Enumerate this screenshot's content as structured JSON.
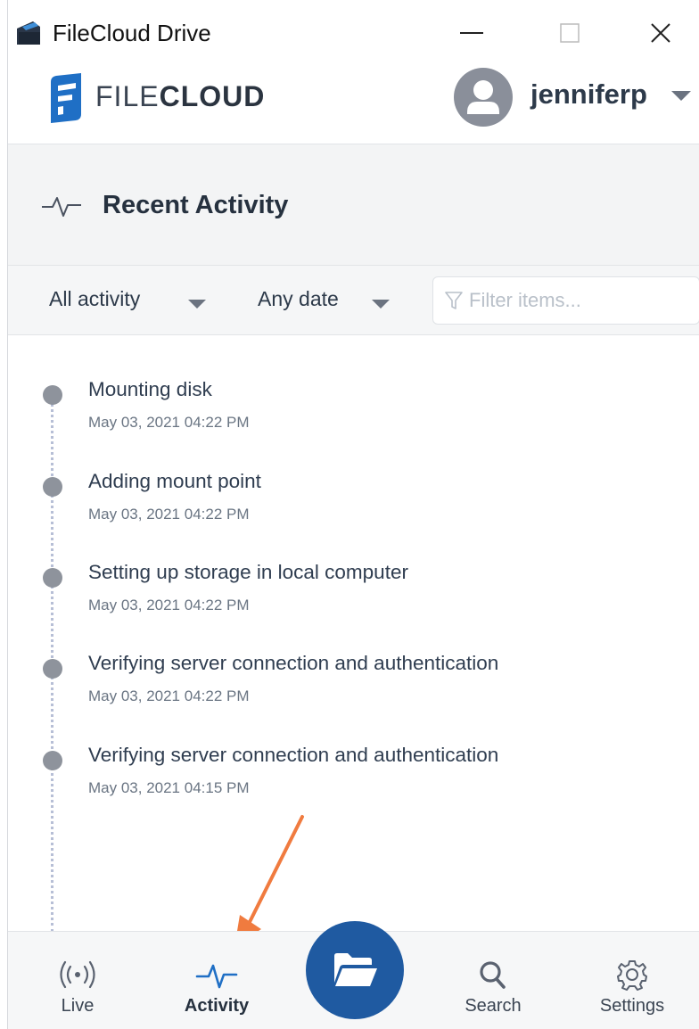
{
  "window": {
    "title": "FileCloud Drive"
  },
  "header": {
    "logo_prefix": "FILE",
    "logo_suffix": "CLOUD",
    "username": "jenniferp"
  },
  "section": {
    "title": "Recent Activity"
  },
  "filters": {
    "activity_select": "All activity",
    "date_select": "Any date",
    "search_placeholder": "Filter items...",
    "search_value": ""
  },
  "activities": [
    {
      "title": "Mounting disk",
      "time": "May 03, 2021 04:22 PM"
    },
    {
      "title": "Adding mount point",
      "time": "May 03, 2021 04:22 PM"
    },
    {
      "title": "Setting up storage in local computer",
      "time": "May 03, 2021 04:22 PM"
    },
    {
      "title": "Verifying server connection and authentication",
      "time": "May 03, 2021 04:22 PM"
    },
    {
      "title": "Verifying server connection and authentication",
      "time": "May 03, 2021 04:15 PM"
    }
  ],
  "nav": {
    "live": "Live",
    "activity": "Activity",
    "search": "Search",
    "settings": "Settings"
  },
  "colors": {
    "accent": "#1f5aa1",
    "annotation_arrow": "#f07b3f",
    "timeline_dot": "#8e939c"
  },
  "icons": {
    "app": "filecloud-app-icon",
    "logo": "filecloud-logo-icon",
    "avatar": "user-avatar-icon",
    "section": "pulse-icon",
    "filter": "funnel-icon",
    "live": "broadcast-icon",
    "activity": "pulse-icon",
    "fab": "folder-open-icon",
    "search": "magnifier-icon",
    "settings": "gear-icon"
  }
}
